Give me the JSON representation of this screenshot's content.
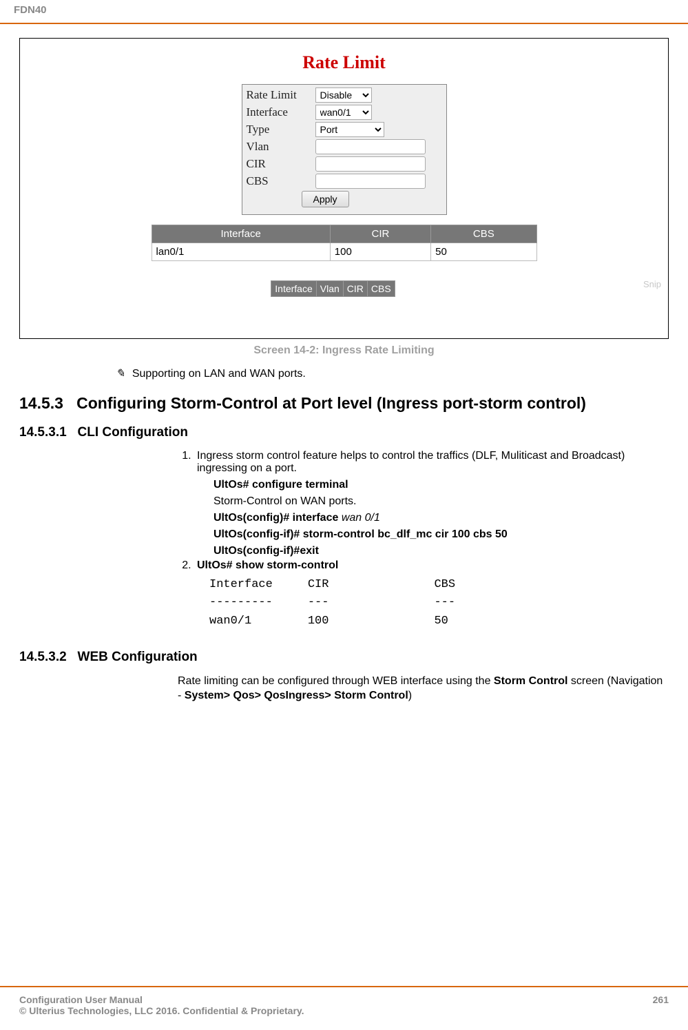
{
  "header": {
    "product": "FDN40"
  },
  "screenshot": {
    "title": "Rate Limit",
    "form": {
      "rows": [
        {
          "label": "Rate Limit",
          "type": "select",
          "value": "Disable"
        },
        {
          "label": "Interface",
          "type": "select",
          "value": "wan0/1"
        },
        {
          "label": "Type",
          "type": "select",
          "value": "Port",
          "wide": true
        },
        {
          "label": "Vlan",
          "type": "input",
          "value": ""
        },
        {
          "label": "CIR",
          "type": "input",
          "value": ""
        },
        {
          "label": "CBS",
          "type": "input",
          "value": ""
        }
      ],
      "apply_label": "Apply"
    },
    "table": {
      "headers": [
        "Interface",
        "CIR",
        "CBS"
      ],
      "rows": [
        {
          "c0": "lan0/1",
          "c1": "100",
          "c2": "50"
        }
      ]
    },
    "mini_headers": [
      "Interface",
      "Vlan",
      "CIR",
      "CBS"
    ],
    "snip": "Snip"
  },
  "caption": "Screen 14-2: Ingress Rate Limiting",
  "note": {
    "pencil": "✎",
    "text": "Supporting on LAN and WAN ports."
  },
  "section": {
    "number": "14.5.3",
    "title": "Configuring Storm-Control at Port level (Ingress port-storm control)"
  },
  "sub1": {
    "number": "14.5.3.1",
    "title": "CLI Configuration",
    "item1_text": "Ingress storm control feature helps to control the traffics (DLF, Muliticast and Broadcast) ingressing on a port.",
    "cli1": "UltOs# configure terminal",
    "cli1_note": "Storm-Control on WAN ports.",
    "cli2a": "UltOs(config)# interface ",
    "cli2b": "wan 0/1",
    "cli3": "UltOs(config-if)# storm-control bc_dlf_mc cir 100 cbs 50",
    "cli4": "UltOs(config-if)#exit",
    "item2_text": "UltOs# show storm-control",
    "output": "Interface     CIR               CBS\n---------     ---               ---\nwan0/1        100               50"
  },
  "sub2": {
    "number": "14.5.3.2",
    "title": "WEB Configuration",
    "para_a": "Rate limiting can be configured through WEB interface using the ",
    "para_b": "Storm Control",
    "para_c": " screen (Navigation - ",
    "para_d": "System> Qos> QosIngress> Storm Control",
    "para_e": ")"
  },
  "footer": {
    "line1": "Configuration User Manual",
    "line2": "© Ulterius Technologies, LLC 2016. Confidential & Proprietary.",
    "page": "261"
  }
}
